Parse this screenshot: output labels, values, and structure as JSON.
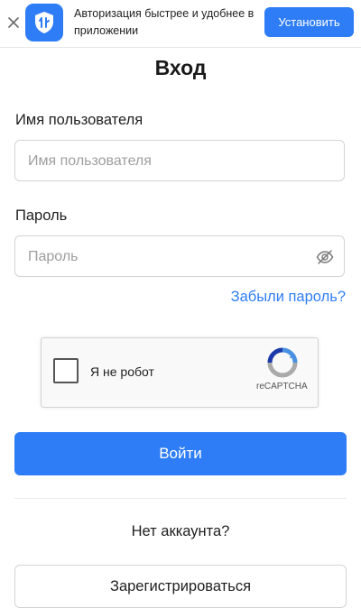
{
  "banner": {
    "text": "Авторизация быстрее и удобнее в приложении",
    "install_label": "Установить",
    "close_icon": "close-icon",
    "app_icon": "shield-icon"
  },
  "page": {
    "title": "Вход"
  },
  "username": {
    "label": "Имя пользователя",
    "placeholder": "Имя пользователя",
    "value": ""
  },
  "password": {
    "label": "Пароль",
    "placeholder": "Пароль",
    "value": "",
    "toggle_icon": "eye-off-icon"
  },
  "forgot_label": "Забыли пароль?",
  "captcha": {
    "checkbox_label": "Я не робот",
    "brand": "reCAPTCHA",
    "checked": false
  },
  "login_label": "Войти",
  "no_account_text": "Нет аккаунта?",
  "register_label": "Зарегистрироваться",
  "colors": {
    "accent": "#2f7df6",
    "border": "#d3d3d3",
    "text": "#1f1f1f",
    "placeholder": "#9e9e9e"
  }
}
